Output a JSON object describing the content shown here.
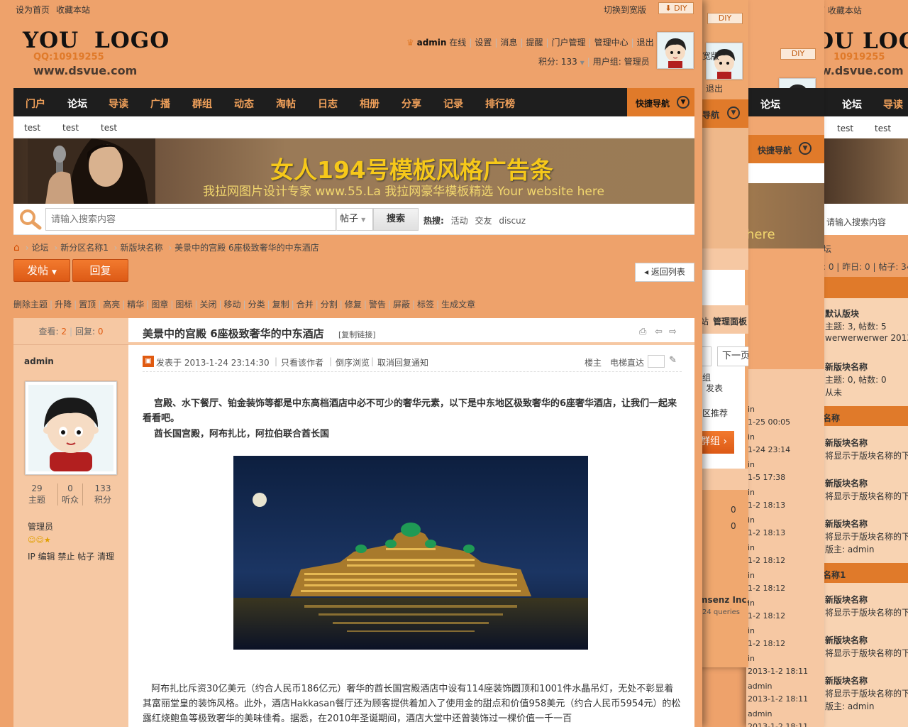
{
  "top": {
    "set_home": "设为首页",
    "bookmark": "收藏本站",
    "switch_width": "切换到宽版",
    "diy": "DIY"
  },
  "logo": {
    "text": "YOU LOGO",
    "qq": "QQ:10919255",
    "site": "www.dsvue.com"
  },
  "user": {
    "name": "admin",
    "status": "在线",
    "links": [
      "设置",
      "消息",
      "提醒",
      "门户管理",
      "管理中心",
      "退出"
    ],
    "points_label": "积分: 133",
    "group_label": "用户组: 管理员"
  },
  "nav": {
    "items": [
      "门户",
      "论坛",
      "导读",
      "广播",
      "群组",
      "动态",
      "淘帖",
      "日志",
      "相册",
      "分享",
      "记录",
      "排行榜"
    ],
    "active": "论坛",
    "quick": "快捷导航"
  },
  "subnav": [
    "test",
    "test",
    "test"
  ],
  "banner": {
    "title": "女人194号模板风格广告条",
    "subtitle": "我拉网图片设计专家 www.55.La 我拉网豪华模板精选 Your website here"
  },
  "search": {
    "placeholder": "请输入搜索内容",
    "type": "帖子",
    "button": "搜索",
    "hot_label": "热搜:",
    "hot": [
      "活动",
      "交友",
      "discuz"
    ]
  },
  "breadcrumb": [
    "论坛",
    "新分区名称1",
    "新版块名称",
    "美景中的宫殿 6座极致奢华的中东酒店"
  ],
  "actions": {
    "post": "发帖",
    "reply": "回复",
    "back": "返回列表"
  },
  "mod": [
    "删除主题",
    "升降",
    "置顶",
    "高亮",
    "精华",
    "图章",
    "图标",
    "关闭",
    "移动",
    "分类",
    "复制",
    "合并",
    "分割",
    "修复",
    "警告",
    "屏蔽",
    "标签",
    "生成文章"
  ],
  "thread": {
    "views_label": "查看:",
    "views": "2",
    "replies_label": "回复:",
    "replies": "0",
    "title": "美景中的宫殿 6座极致奢华的中东酒店",
    "copy_link": "[复制链接]"
  },
  "author": {
    "name": "admin",
    "stats": [
      {
        "v": "29",
        "l": "主题"
      },
      {
        "v": "0",
        "l": "听众"
      },
      {
        "v": "133",
        "l": "积分"
      }
    ],
    "group": "管理员",
    "tools": [
      "IP",
      "编辑",
      "禁止",
      "帖子",
      "清理"
    ]
  },
  "post": {
    "meta": "发表于 2013-1-24 23:14:30",
    "only_author": "只看该作者",
    "reverse": "倒序浏览",
    "cancel_notify": "取消回复通知",
    "floor": "楼主",
    "elevator": "电梯直达",
    "p1": "宫殿、水下餐厅、铂金装饰等都是中东高档酒店中必不可少的奢华元素，以下是中东地区极致奢华的6座奢华酒店，让我们一起来看看吧。",
    "p2": "酋长国宫殿，阿布扎比，阿拉伯联合酋长国",
    "p3": "阿布扎比斥资30亿美元（约合人民币186亿元）奢华的酋长国宫殿酒店中设有114座装饰圆顶和1001件水晶吊灯，无处不彰显着其富丽堂皇的装饰风格。此外，酒店Hakkasan餐厅还为顾客提供着加入了使用金的甜点和价值958美元（约合人民币5954元）的松露红烧鲍鱼等极致奢华的美味佳肴。据悉，在2010年圣诞期间，酒店大堂中还曾装饰过一棵价值一千一百"
  },
  "layer1": {
    "diy": "DIY",
    "texts": [
      "宽版",
      "退出",
      "理员",
      "导航",
      "站",
      "管理面板",
      "页",
      "下一页",
      "发表",
      "组",
      "区推荐",
      "群组",
      "0",
      "0",
      "msenz Inc.",
      "24 queries"
    ]
  },
  "layer2": {
    "diy": "DIY",
    "quick": "快捷导航",
    "here": "here",
    "tab": "论坛",
    "times": [
      "in",
      "1-25 00:05",
      "in",
      "1-24 23:14",
      "in",
      "1-5 17:38",
      "in",
      "1-2 18:13",
      "in",
      "1-2 18:13",
      "in",
      "1-2 18:12",
      "in",
      "1-2 18:12",
      "in",
      "1-2 18:12",
      "in",
      "1-2 18:12",
      "in",
      "2013-1-2 18:11",
      "admin",
      "2013-1-2 18:11",
      "admin",
      "2013-1-2 18:11"
    ]
  },
  "layer3": {
    "top": "设为首页 收藏本站",
    "logo": "YOU LOC",
    "qq": "10919255",
    "site": "w.dsvue.com",
    "nav": [
      "论坛",
      "导读"
    ],
    "sub": [
      "test",
      "test"
    ],
    "search": "请输入搜索内容",
    "stats": "坛",
    "stat2": ": 0  |  昨日: 0  |  帖子: 34",
    "forums": [
      "默认版块",
      "新版块名称",
      "名称",
      "新版块名称",
      "新版块名称",
      "新版块名称",
      "名称1",
      "新版块名称",
      "新版块名称",
      "新版块名称"
    ]
  }
}
